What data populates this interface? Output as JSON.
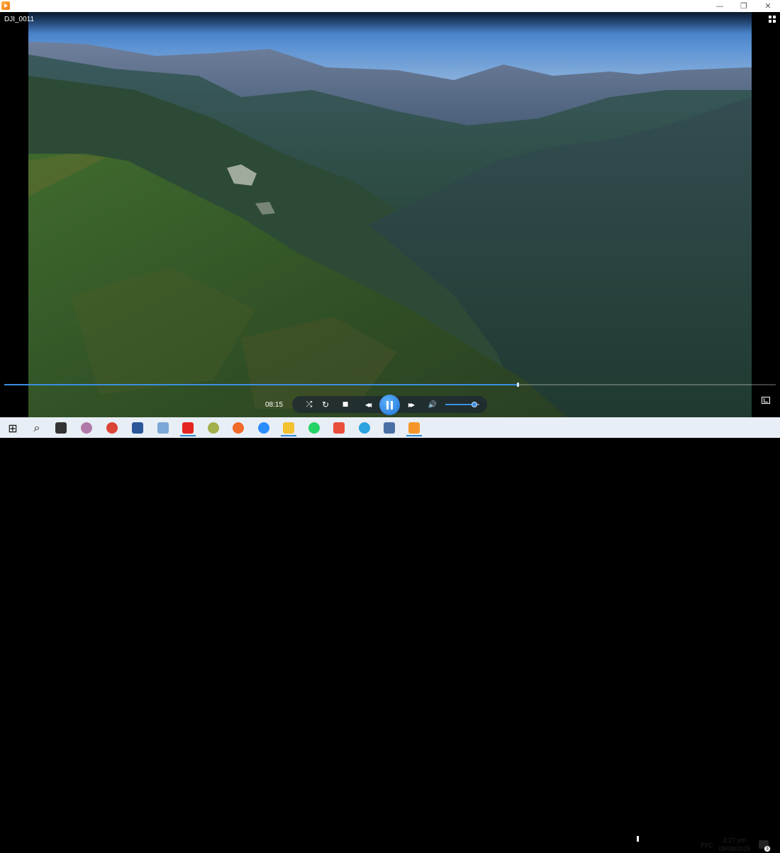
{
  "window": {
    "title": "DJI_0011",
    "minimize_glyph": "—",
    "restore_glyph": "❐",
    "close_glyph": "✕"
  },
  "player": {
    "elapsed": "08:15",
    "progress": 0.665,
    "volume": 0.85,
    "controls": {
      "repeat_glyph": "↻",
      "stop_glyph": "■",
      "rewind_glyph": "◀◀",
      "forward_glyph": "▶▶",
      "volume_glyph": "🔊",
      "shuffle_glyph": "⤮"
    },
    "accent": "#3b8fe0"
  },
  "taskbar": {
    "start_glyph": "⊞",
    "search_glyph": "⌕",
    "apps": [
      {
        "name": "task-view",
        "color": "#333"
      },
      {
        "name": "app-disc",
        "color": "#b07aa8"
      },
      {
        "name": "chrome",
        "color": "#db4437"
      },
      {
        "name": "word",
        "color": "#2b579a"
      },
      {
        "name": "app-feather",
        "color": "#7aa7d6"
      },
      {
        "name": "yandex",
        "color": "#e52620"
      },
      {
        "name": "app-eye",
        "color": "#a3b04b"
      },
      {
        "name": "app-ball",
        "color": "#f06a2a"
      },
      {
        "name": "zoom",
        "color": "#2d8cff"
      },
      {
        "name": "file-explorer",
        "color": "#f2c230"
      },
      {
        "name": "whatsapp",
        "color": "#25d366"
      },
      {
        "name": "app-brush",
        "color": "#e94e3c"
      },
      {
        "name": "telegram",
        "color": "#2aa3e0"
      },
      {
        "name": "app-arrow",
        "color": "#4a6fa5"
      },
      {
        "name": "media-player",
        "color": "#f5962a"
      }
    ],
    "language": "РУС",
    "time": "2:27 pm",
    "date": "09/08/2025",
    "notifications": "3"
  }
}
